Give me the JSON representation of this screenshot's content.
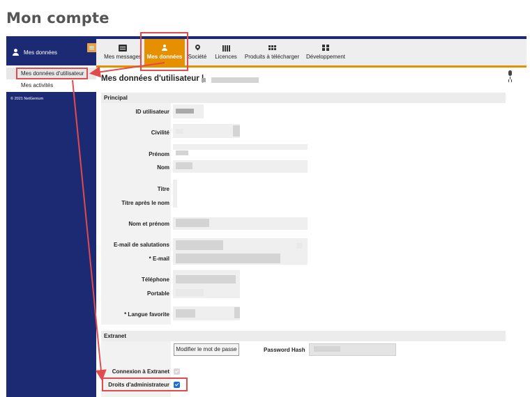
{
  "page": {
    "heading": "Mon compte"
  },
  "sidebar": {
    "header_label": "Mes données",
    "items": [
      {
        "label": "Mes données d'utilisateur",
        "selected": true
      },
      {
        "label": "Mes activités",
        "selected": false
      }
    ],
    "copyright": "© 2021 NetGenium"
  },
  "nav": {
    "tabs": [
      {
        "label": "Mes messages",
        "icon": "message-icon",
        "active": false
      },
      {
        "label": "Mes données",
        "icon": "user-icon",
        "active": true
      },
      {
        "label": "Société",
        "icon": "map-pin-icon",
        "active": false
      },
      {
        "label": "Licences",
        "icon": "license-bars-icon",
        "active": false
      },
      {
        "label": "Produits à télécharger",
        "icon": "grid-icon",
        "active": false
      },
      {
        "label": "Développement",
        "icon": "blocks-icon",
        "active": false
      }
    ]
  },
  "content": {
    "title": "Mes données d'utilisateur |",
    "sections": {
      "principal": "Principal",
      "extranet": "Extranet"
    },
    "fields": {
      "id_utilisateur": "ID utilisateur",
      "civilite": "Civilité",
      "prenom": "Prénom",
      "nom": "Nom",
      "titre": "Titre",
      "titre_apres": "Titre après le nom",
      "nom_prenom": "Nom et prénom",
      "email_salutations": "E-mail de salutations",
      "email": "* E-mail",
      "telephone": "Téléphone",
      "portable": "Portable",
      "langue": "* Langue favorite",
      "password_hash": "Password Hash",
      "connexion_extranet": "Connexion à Extranet",
      "droits_admin": "Droits d'administrateur"
    },
    "buttons": {
      "change_password": "Modifier le mot de passe"
    },
    "checkboxes": {
      "connexion_extranet": true,
      "droits_admin": true
    }
  },
  "colors": {
    "navy": "#1c2a73",
    "orange": "#e69000",
    "annotation_red": "#e24b4b",
    "checkbox_blue": "#1f6fd1"
  }
}
